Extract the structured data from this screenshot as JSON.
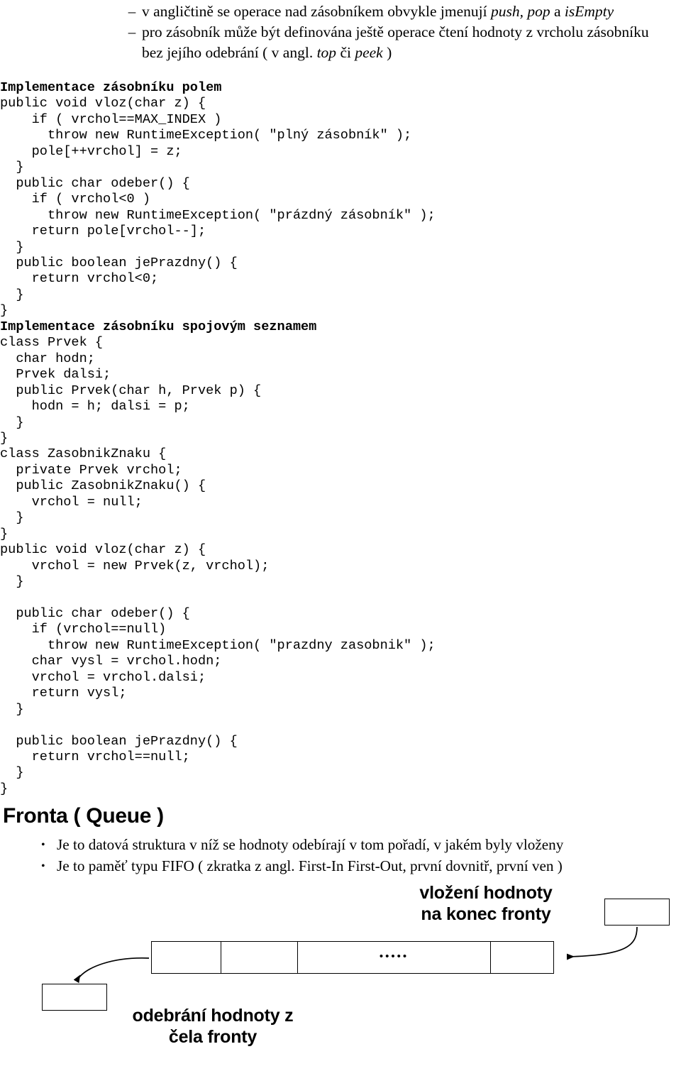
{
  "intro_bullets": [
    {
      "marker": "–",
      "segments": [
        {
          "text": "v angličtině se operace nad zásobníkem obvykle jmenují ",
          "style": "normal"
        },
        {
          "text": "push, pop",
          "style": "italic"
        },
        {
          "text": " a ",
          "style": "normal"
        },
        {
          "text": "isEmpty",
          "style": "italic"
        }
      ]
    },
    {
      "marker": "–",
      "segments": [
        {
          "text": "pro zásobník může být definována ještě operace čtení hodnoty z vrcholu zásobníku bez jejího odebrání ( v angl. ",
          "style": "normal"
        },
        {
          "text": "top",
          "style": "italic"
        },
        {
          "text": " či ",
          "style": "normal"
        },
        {
          "text": "peek",
          "style": "italic"
        },
        {
          "text": " )",
          "style": "normal"
        }
      ]
    }
  ],
  "code": {
    "lines": [
      {
        "text": "Implementace zásobníku polem",
        "bold": true
      },
      {
        "text": "public void vloz(char z) {",
        "bold": false
      },
      {
        "text": "    if ( vrchol==MAX_INDEX )",
        "bold": false
      },
      {
        "text": "      throw new RuntimeException( \"plný zásobník\" );",
        "bold": false
      },
      {
        "text": "    pole[++vrchol] = z;",
        "bold": false
      },
      {
        "text": "  }",
        "bold": false
      },
      {
        "text": "  public char odeber() {",
        "bold": false
      },
      {
        "text": "    if ( vrchol<0 )",
        "bold": false
      },
      {
        "text": "      throw new RuntimeException( \"prázdný zásobník\" );",
        "bold": false
      },
      {
        "text": "    return pole[vrchol--];",
        "bold": false
      },
      {
        "text": "  }",
        "bold": false
      },
      {
        "text": "  public boolean jePrazdny() {",
        "bold": false
      },
      {
        "text": "    return vrchol<0;",
        "bold": false
      },
      {
        "text": "  }",
        "bold": false
      },
      {
        "text": "}",
        "bold": false
      },
      {
        "text": "Implementace zásobníku spojovým seznamem",
        "bold": true
      },
      {
        "text": "class Prvek {",
        "bold": false
      },
      {
        "text": "  char hodn;",
        "bold": false
      },
      {
        "text": "  Prvek dalsi;",
        "bold": false
      },
      {
        "text": "  public Prvek(char h, Prvek p) {",
        "bold": false
      },
      {
        "text": "    hodn = h; dalsi = p;",
        "bold": false
      },
      {
        "text": "  }",
        "bold": false
      },
      {
        "text": "}",
        "bold": false
      },
      {
        "text": "class ZasobnikZnaku {",
        "bold": false
      },
      {
        "text": "  private Prvek vrchol;",
        "bold": false
      },
      {
        "text": "  public ZasobnikZnaku() {",
        "bold": false
      },
      {
        "text": "    vrchol = null;",
        "bold": false
      },
      {
        "text": "  }",
        "bold": false
      },
      {
        "text": "}",
        "bold": false
      },
      {
        "text": "public void vloz(char z) {",
        "bold": false
      },
      {
        "text": "    vrchol = new Prvek(z, vrchol);",
        "bold": false
      },
      {
        "text": "  }",
        "bold": false
      },
      {
        "text": "",
        "bold": false
      },
      {
        "text": "  public char odeber() {",
        "bold": false
      },
      {
        "text": "    if (vrchol==null)",
        "bold": false
      },
      {
        "text": "      throw new RuntimeException( \"prazdny zasobnik\" );",
        "bold": false
      },
      {
        "text": "    char vysl = vrchol.hodn;",
        "bold": false
      },
      {
        "text": "    vrchol = vrchol.dalsi;",
        "bold": false
      },
      {
        "text": "    return vysl;",
        "bold": false
      },
      {
        "text": "  }",
        "bold": false
      },
      {
        "text": "",
        "bold": false
      },
      {
        "text": "  public boolean jePrazdny() {",
        "bold": false
      },
      {
        "text": "    return vrchol==null;",
        "bold": false
      },
      {
        "text": "  }",
        "bold": false
      },
      {
        "text": "}",
        "bold": false
      }
    ]
  },
  "queue_section": {
    "heading": "Fronta ( Queue )",
    "bullets": [
      {
        "marker": "•",
        "text": "Je to datová struktura v níž se hodnoty odebírají v tom pořadí, v jakém byly vloženy"
      },
      {
        "marker": "•",
        "text": "Je to paměť typu FIFO ( zkratka z angl. First-In First-Out, první dovnitř, první ven )"
      }
    ]
  },
  "diagram": {
    "enqueue_label": "vložení hodnoty\nna konec fronty",
    "dequeue_label": "odebrání hodnoty z\nčela fronty",
    "cell_ellipsis": "•••••",
    "cell_count": 4,
    "stroke_color": "#000000"
  }
}
